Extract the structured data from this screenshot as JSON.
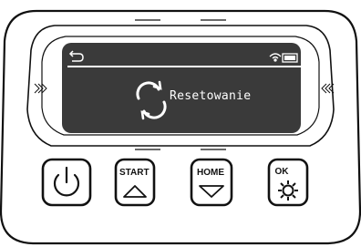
{
  "screen": {
    "status_text": "Resetowanie",
    "status_icon": "sync-icon",
    "back_icon": "back-arrow-icon",
    "wifi_icon": "wifi-icon",
    "battery_icon": "battery-icon"
  },
  "buttons": {
    "power": {
      "icon": "power-icon"
    },
    "start": {
      "label": "START",
      "icon": "triangle-up-icon"
    },
    "home": {
      "label": "HOME",
      "icon": "triangle-down-icon"
    },
    "ok": {
      "label": "OK",
      "icon": "gear-icon"
    }
  },
  "colors": {
    "screen_bg": "#3a3a3a",
    "screen_fg": "#ffffff",
    "outline": "#111111"
  }
}
